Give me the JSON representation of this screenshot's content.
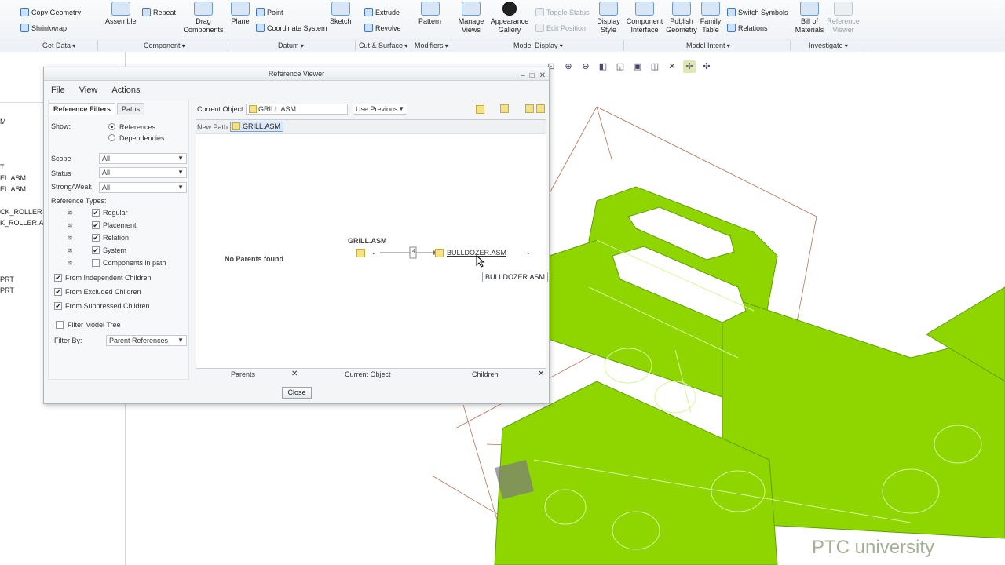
{
  "ribbon": {
    "copy_geometry": "Copy Geometry",
    "shrinkwrap": "Shrinkwrap",
    "assemble": "Assemble",
    "repeat": "Repeat",
    "drag_components": "Drag Components",
    "plane": "Plane",
    "point": "Point",
    "coordinate_system": "Coordinate System",
    "sketch": "Sketch",
    "extrude": "Extrude",
    "revolve": "Revolve",
    "pattern": "Pattern",
    "manage_views": "Manage Views",
    "appearance_gallery": "Appearance Gallery",
    "toggle_status": "Toggle Status",
    "edit_position": "Edit Position",
    "display_style": "Display Style",
    "component_interface": "Component Interface",
    "publish_geometry": "Publish Geometry",
    "family_table": "Family Table",
    "switch_symbols": "Switch Symbols",
    "relations": "Relations",
    "bill_of_materials": "Bill of Materials",
    "reference_viewer": "Reference Viewer",
    "groups": [
      "Get Data",
      "Component",
      "Datum",
      "Cut & Surface",
      "Modifiers",
      "Model Display",
      "Model Intent",
      "Investigate"
    ]
  },
  "tree": {
    "items": [
      "M",
      "T",
      "EL.ASM",
      "EL.ASM",
      "CK_ROLLER",
      "K_ROLLER.A",
      "PRT",
      "PRT"
    ]
  },
  "dialog": {
    "title": "Reference Viewer",
    "menu": [
      "File",
      "View",
      "Actions"
    ],
    "tabs": [
      "Reference Filters",
      "Paths"
    ],
    "show_label": "Show:",
    "show_options": [
      "References",
      "Dependencies"
    ],
    "scope_label": "Scope",
    "scope_value": "All",
    "status_label": "Status",
    "status_value": "All",
    "strongweak_label": "Strong/Weak",
    "strongweak_value": "All",
    "reference_types_label": "Reference Types:",
    "reference_types": [
      {
        "label": "Regular",
        "checked": true
      },
      {
        "label": "Placement",
        "checked": true
      },
      {
        "label": "Relation",
        "checked": true
      },
      {
        "label": "System",
        "checked": true
      },
      {
        "label": "Components in path",
        "checked": false
      }
    ],
    "from_options": [
      {
        "label": "From Independent Children",
        "checked": true
      },
      {
        "label": "From Excluded Children",
        "checked": true
      },
      {
        "label": "From Suppressed Children",
        "checked": true
      }
    ],
    "filter_model_tree": "Filter Model Tree",
    "filter_by_label": "Filter By:",
    "filter_by_value": "Parent References",
    "current_object_label": "Current Object:",
    "current_object_value": "GRILL.ASM",
    "use_previous": "Use Previous",
    "new_path_label": "New Path:",
    "new_path_value": "GRILL.ASM",
    "no_parents": "No Parents found",
    "center_node": "GRILL.ASM",
    "link_count": "4",
    "child_node": "BULLDOZER.ASM",
    "tooltip": "BULLDOZER.ASM",
    "footer": {
      "parents": "Parents",
      "current": "Current Object",
      "children": "Children"
    },
    "close": "Close"
  },
  "watermark": "PTC university"
}
